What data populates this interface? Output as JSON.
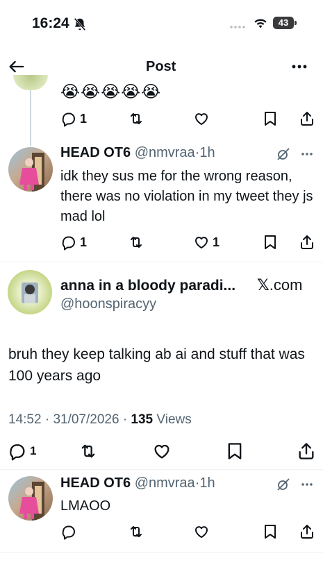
{
  "status_bar": {
    "time": "16:24",
    "battery": "43"
  },
  "header": {
    "title": "Post"
  },
  "reply_top": {
    "emojis": "😭😭😭😭😭",
    "reply_count": "1"
  },
  "reply_1": {
    "name": "HEAD OT6",
    "handle": "@nmvraa",
    "dot": "·",
    "time": "1h",
    "text": "idk they sus me for the wrong reason, there was no violation in my tweet they js mad lol",
    "reply_count": "1",
    "like_count": "1"
  },
  "main_post": {
    "name": "anna in a bloody paradi...",
    "handle": "@hoonspiracyy",
    "source_logo": "𝕏",
    "source_suffix": ".com",
    "text": "bruh they keep talking ab ai and stuff that was 100 years ago",
    "time": "14:52",
    "dot1": "·",
    "date": "31/07/2026",
    "dot2": "·",
    "views_count": "135",
    "views_label": "Views",
    "reply_count": "1"
  },
  "reply_2": {
    "name": "HEAD OT6",
    "handle": "@nmvraa",
    "dot": "·",
    "time": "1h",
    "text": "LMAOO"
  },
  "colors": {
    "text": "#0f1419",
    "secondary": "#536471",
    "divider": "#eff3f4",
    "thread_line": "#cfd9de"
  },
  "icons": [
    "back-arrow-icon",
    "more-icon",
    "reply-icon",
    "retweet-icon",
    "like-icon",
    "bookmark-icon",
    "share-icon",
    "grok-icon",
    "wifi-icon",
    "signal-icon",
    "battery-icon",
    "bell-slash-icon"
  ]
}
